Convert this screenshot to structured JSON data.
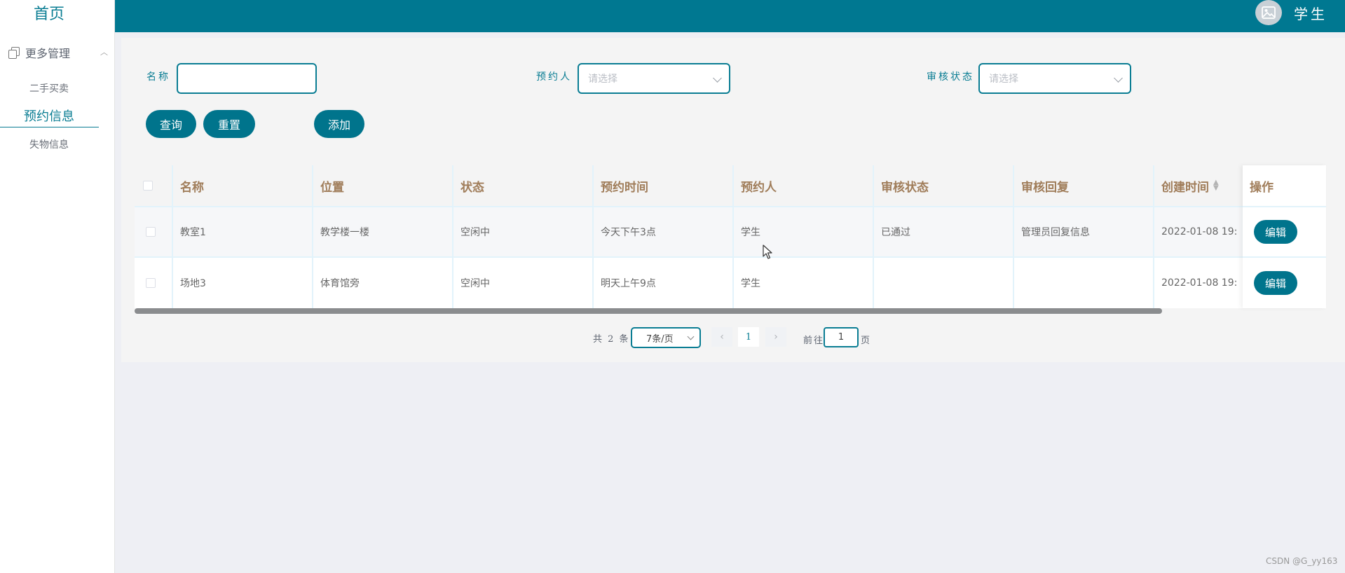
{
  "sidebar": {
    "home": "首页",
    "group": "更多管理",
    "items": [
      {
        "label": "二手买卖"
      },
      {
        "label": "预约信息"
      },
      {
        "label": "失物信息"
      }
    ]
  },
  "topbar": {
    "user": "学生"
  },
  "filters": {
    "name_label": "名称",
    "reserver_label": "预约人",
    "reserver_placeholder": "请选择",
    "status_label": "审核状态",
    "status_placeholder": "请选择"
  },
  "buttons": {
    "query": "查询",
    "reset": "重置",
    "add": "添加"
  },
  "table": {
    "columns": [
      "名称",
      "位置",
      "状态",
      "预约时间",
      "预约人",
      "审核状态",
      "审核回复",
      "创建时间",
      "操作"
    ],
    "rows": [
      {
        "name": "教室1",
        "location": "教学楼一楼",
        "state": "空闲中",
        "time": "今天下午3点",
        "reserver": "学生",
        "audit": "已通过",
        "reply": "管理员回复信息",
        "created": "2022-01-08 19:",
        "action": "编辑"
      },
      {
        "name": "场地3",
        "location": "体育馆旁",
        "state": "空闲中",
        "time": "明天上午9点",
        "reserver": "学生",
        "audit": "",
        "reply": "",
        "created": "2022-01-08 19:",
        "action": "编辑"
      }
    ]
  },
  "pagination": {
    "total": "共 2 条",
    "page_size": "7条/页",
    "prev_icon": "‹",
    "current": "1",
    "next_icon": "›",
    "goto_label": "前往",
    "goto_value": "1",
    "page_suffix": "页"
  },
  "watermark": "CSDN @G_yy163",
  "colors": {
    "primary": "#007891",
    "header_text": "#a07d5a"
  }
}
